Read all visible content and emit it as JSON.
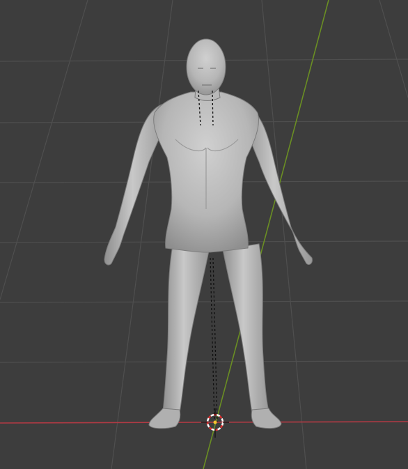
{
  "viewport": {
    "type": "3d-viewport",
    "background_color": "#3d3d3d",
    "grid_color": "#555555",
    "x_axis_color": "#b23a44",
    "y_axis_color": "#6a8e23"
  },
  "scene": {
    "object": "human-male-mesh",
    "mesh_color": "#b5b5b5",
    "pose": "a-pose"
  },
  "cursor": {
    "icon": "3d-cursor-icon",
    "ring_colors": [
      "#ffffff",
      "#e03030"
    ],
    "center_color": "#f4c430"
  },
  "relationship_lines": {
    "style": "dashed",
    "color": "#000000"
  }
}
